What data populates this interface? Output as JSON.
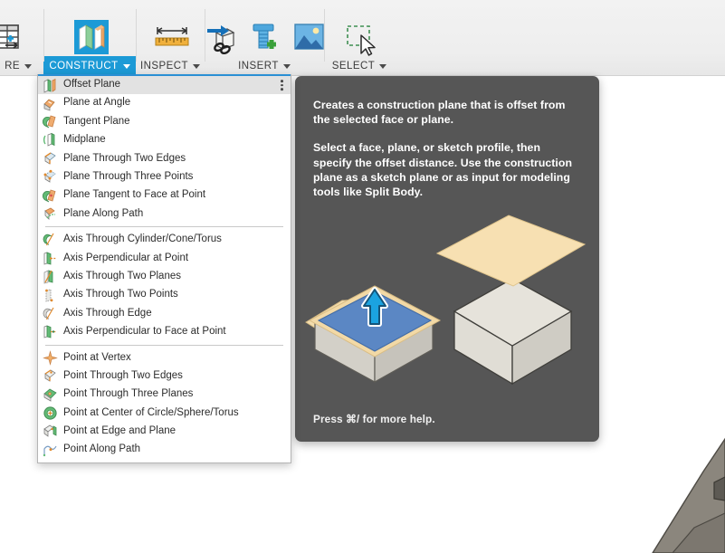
{
  "toolbar": {
    "groups": [
      {
        "name": "measure",
        "label": "RE",
        "has_caret": true,
        "active": false,
        "icons": [
          "table-add-icon"
        ]
      },
      {
        "name": "construct",
        "label": "CONSTRUCT",
        "has_caret": true,
        "active": true,
        "icons": [
          "construct-planes-icon"
        ]
      },
      {
        "name": "inspect",
        "label": "INSPECT",
        "has_caret": true,
        "active": false,
        "icons": [
          "measure-ruler-icon"
        ]
      },
      {
        "name": "insert",
        "label": "INSERT",
        "has_caret": true,
        "active": false,
        "icons": [
          "derive-link-icon",
          "insert-mcmaster-bolt-icon",
          "insert-image-icon"
        ]
      },
      {
        "name": "select",
        "label": "SELECT",
        "has_caret": true,
        "active": false,
        "icons": [
          "select-window-cursor-icon"
        ]
      }
    ],
    "accent_color": "#1c9ad6",
    "band_color": "#eeeeee"
  },
  "menu": {
    "name": "construct-dropdown",
    "selected_index": 0,
    "overflow_icon": "three-dots-vertical-icon",
    "groups": [
      {
        "items": [
          {
            "label": "Offset Plane",
            "icon": "offset-plane-icon"
          },
          {
            "label": "Plane at Angle",
            "icon": "plane-at-angle-icon"
          },
          {
            "label": "Tangent Plane",
            "icon": "tangent-plane-icon"
          },
          {
            "label": "Midplane",
            "icon": "midplane-icon"
          },
          {
            "label": "Plane Through Two Edges",
            "icon": "plane-two-edges-icon"
          },
          {
            "label": "Plane Through Three Points",
            "icon": "plane-three-points-icon"
          },
          {
            "label": "Plane Tangent to Face at Point",
            "icon": "plane-tangent-face-point-icon"
          },
          {
            "label": "Plane Along Path",
            "icon": "plane-along-path-icon"
          }
        ]
      },
      {
        "items": [
          {
            "label": "Axis Through Cylinder/Cone/Torus",
            "icon": "axis-cylinder-cone-torus-icon"
          },
          {
            "label": "Axis Perpendicular at Point",
            "icon": "axis-perpendicular-point-icon"
          },
          {
            "label": "Axis Through Two Planes",
            "icon": "axis-two-planes-icon"
          },
          {
            "label": "Axis Through Two Points",
            "icon": "axis-two-points-icon"
          },
          {
            "label": "Axis Through Edge",
            "icon": "axis-through-edge-icon"
          },
          {
            "label": "Axis Perpendicular to Face at Point",
            "icon": "axis-perpendicular-face-point-icon"
          }
        ]
      },
      {
        "items": [
          {
            "label": "Point at Vertex",
            "icon": "point-at-vertex-icon"
          },
          {
            "label": "Point Through Two Edges",
            "icon": "point-two-edges-icon"
          },
          {
            "label": "Point Through Three Planes",
            "icon": "point-three-planes-icon"
          },
          {
            "label": "Point at Center of Circle/Sphere/Torus",
            "icon": "point-center-circle-icon"
          },
          {
            "label": "Point at Edge and Plane",
            "icon": "point-edge-plane-icon"
          },
          {
            "label": "Point Along Path",
            "icon": "point-along-path-icon"
          }
        ]
      }
    ]
  },
  "tooltip": {
    "name": "offset-plane-tooltip",
    "paragraph1": "Creates a construction plane that is offset from the selected face or plane.",
    "paragraph2": "Select a face, plane, or sketch profile, then specify the offset distance. Use the construction plane as a sketch plane or as input for modeling tools like Split Body.",
    "footer": "Press ⌘/ for more help.",
    "background_color": "#565656",
    "illustration": {
      "name": "offset-plane-illustration",
      "left_solid_top_face_color": "#5b87c4",
      "plane_color": "#f6dfb0",
      "body_color": "#dcd9d2",
      "arrow_color": "#1ba3e0"
    }
  },
  "canvas": {
    "background_color": "#ffffff",
    "model_fragment_color": "#87827a"
  }
}
